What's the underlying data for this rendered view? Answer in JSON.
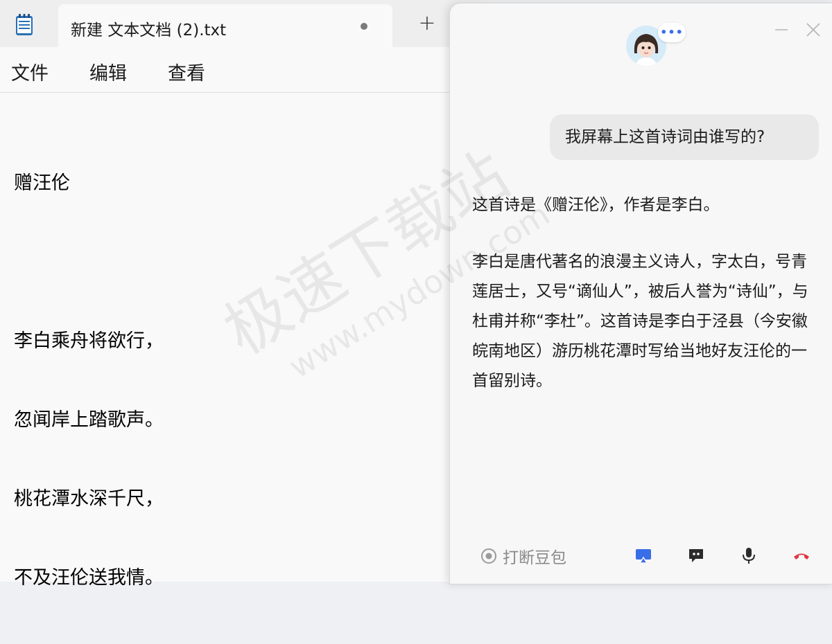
{
  "notepad": {
    "tab_title": "新建 文本文档 (2).txt",
    "new_tab_label": "+",
    "menu": [
      "文件",
      "编辑",
      "查看"
    ],
    "content": [
      "赠汪伦",
      "",
      "李白乘舟将欲行，",
      "忽闻岸上踏歌声。",
      "桃花潭水深千尺，",
      "不及汪伦送我情。"
    ]
  },
  "watermark": {
    "text": "极速下载站",
    "url": "www.mydown.com"
  },
  "assistant": {
    "dots_label": "•••",
    "user_message": "我屏幕上这首诗词由谁写的?",
    "reply_line_1": "这首诗是《赠汪伦》，作者是李白。",
    "reply_paragraph": "李白是唐代著名的浪漫主义诗人，字太白，号青莲居士，又号“谪仙人”，被后人誉为“诗仙”，与杜甫并称“李杜”。这首诗是李白于泾县（今安徽皖南地区）游历桃花潭时写给当地好友汪伦的一首留别诗。",
    "interrupt_label": "打断豆包",
    "colors": {
      "accent_blue": "#3a6ee8",
      "hangup_red": "#e0383e"
    }
  }
}
